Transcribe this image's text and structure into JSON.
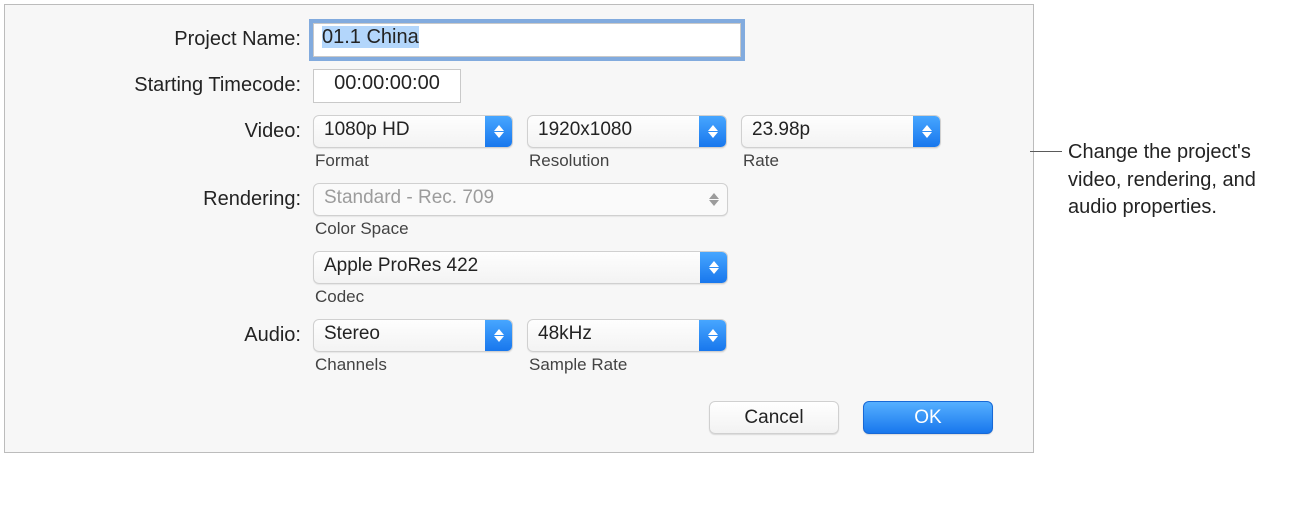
{
  "labels": {
    "project_name": "Project Name:",
    "starting_tc": "Starting Timecode:",
    "video": "Video:",
    "rendering": "Rendering:",
    "audio": "Audio:"
  },
  "sublabels": {
    "format": "Format",
    "resolution": "Resolution",
    "rate": "Rate",
    "color_space": "Color Space",
    "codec": "Codec",
    "channels": "Channels",
    "sample_rate": "Sample Rate"
  },
  "values": {
    "project_name": "01.1 China",
    "starting_tc": "00:00:00:00",
    "format": "1080p HD",
    "resolution": "1920x1080",
    "rate": "23.98p",
    "color_space": "Standard - Rec. 709",
    "codec": "Apple ProRes 422",
    "channels": "Stereo",
    "sample_rate": "48kHz"
  },
  "buttons": {
    "cancel": "Cancel",
    "ok": "OK"
  },
  "callout": "Change the project's video, rendering, and audio properties."
}
